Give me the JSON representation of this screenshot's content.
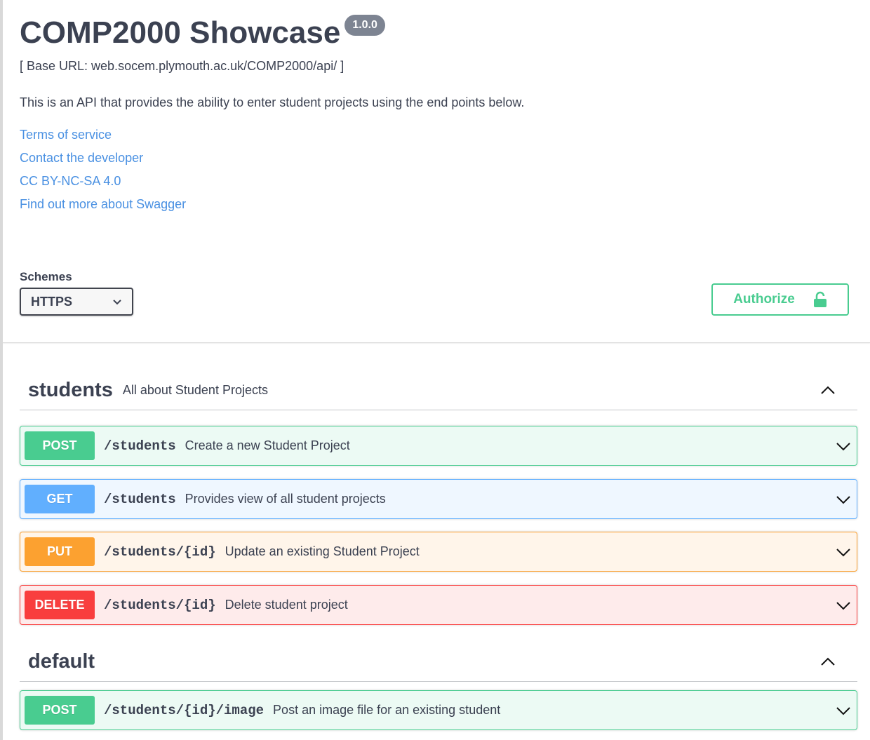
{
  "info": {
    "title": "COMP2000 Showcase",
    "version": "1.0.0",
    "base_url": "[ Base URL: web.socem.plymouth.ac.uk/COMP2000/api/ ]",
    "description": "This is an API that provides the ability to enter student projects using the end points below.",
    "links": [
      {
        "label": "Terms of service"
      },
      {
        "label": "Contact the developer"
      },
      {
        "label": "CC BY-NC-SA 4.0"
      },
      {
        "label": "Find out more about Swagger"
      }
    ]
  },
  "schemes": {
    "label": "Schemes",
    "selected": "HTTPS"
  },
  "authorize": {
    "label": "Authorize",
    "icon": "lock-icon",
    "color": "#49cc90"
  },
  "tags": [
    {
      "name": "students",
      "description": "All about Student Projects",
      "operations": [
        {
          "method": "POST",
          "path": "/students",
          "summary": "Create a new Student Project"
        },
        {
          "method": "GET",
          "path": "/students",
          "summary": "Provides view of all student projects"
        },
        {
          "method": "PUT",
          "path": "/students/{id}",
          "summary": "Update an existing Student Project"
        },
        {
          "method": "DELETE",
          "path": "/students/{id}",
          "summary": "Delete student project"
        }
      ]
    },
    {
      "name": "default",
      "description": "",
      "operations": [
        {
          "method": "POST",
          "path": "/students/{id}/image",
          "summary": "Post an image file for an existing student"
        }
      ]
    }
  ],
  "colors": {
    "post": "#49cc90",
    "get": "#61affe",
    "put": "#fca130",
    "delete": "#f93e3e",
    "link": "#4990e2",
    "text": "#3b4151"
  }
}
